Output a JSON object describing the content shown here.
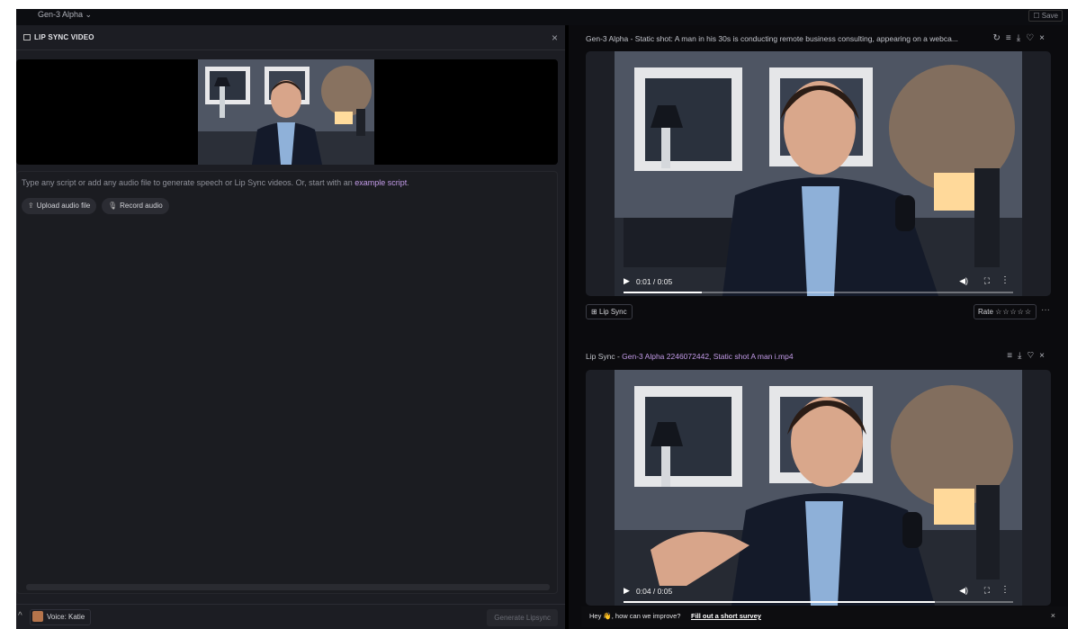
{
  "top_bar": {
    "model_label": "Gen-3 Alpha ⌄",
    "save_label": "☐ Save"
  },
  "left_panel": {
    "title": "LIP SYNC VIDEO",
    "hint_text": "Type any script or add any audio file to generate speech or Lip Sync videos. Or, start with an ",
    "hint_link": "example script",
    "hint_end": ".",
    "upload_label": "Upload audio file",
    "record_label": "Record audio",
    "voice_label": "Voice: Katie",
    "generate_label": "Generate Lipsync"
  },
  "right_panel": {
    "video1": {
      "title": "Gen-3 Alpha - Static shot: A man in his 30s is conducting remote business consulting, appearing on a webca...",
      "time": "0:01 / 0:05",
      "progress": 0.2
    },
    "lip_sync_button": "Lip Sync",
    "rate_label": "Rate",
    "rate_stars": "☆☆☆☆☆",
    "video2": {
      "title_prefix": "Lip Sync - ",
      "title_accent": "Gen-3 Alpha 2246072442, Static shot A man i.mp4",
      "time": "0:04 / 0:05",
      "progress": 0.8
    }
  },
  "banner": {
    "message": "Hey 👋, how can we improve?",
    "link": "Fill out a short survey"
  },
  "colors": {
    "accent": "#c39be8",
    "panel": "#1c1d23",
    "background": "#0b0b0e"
  }
}
